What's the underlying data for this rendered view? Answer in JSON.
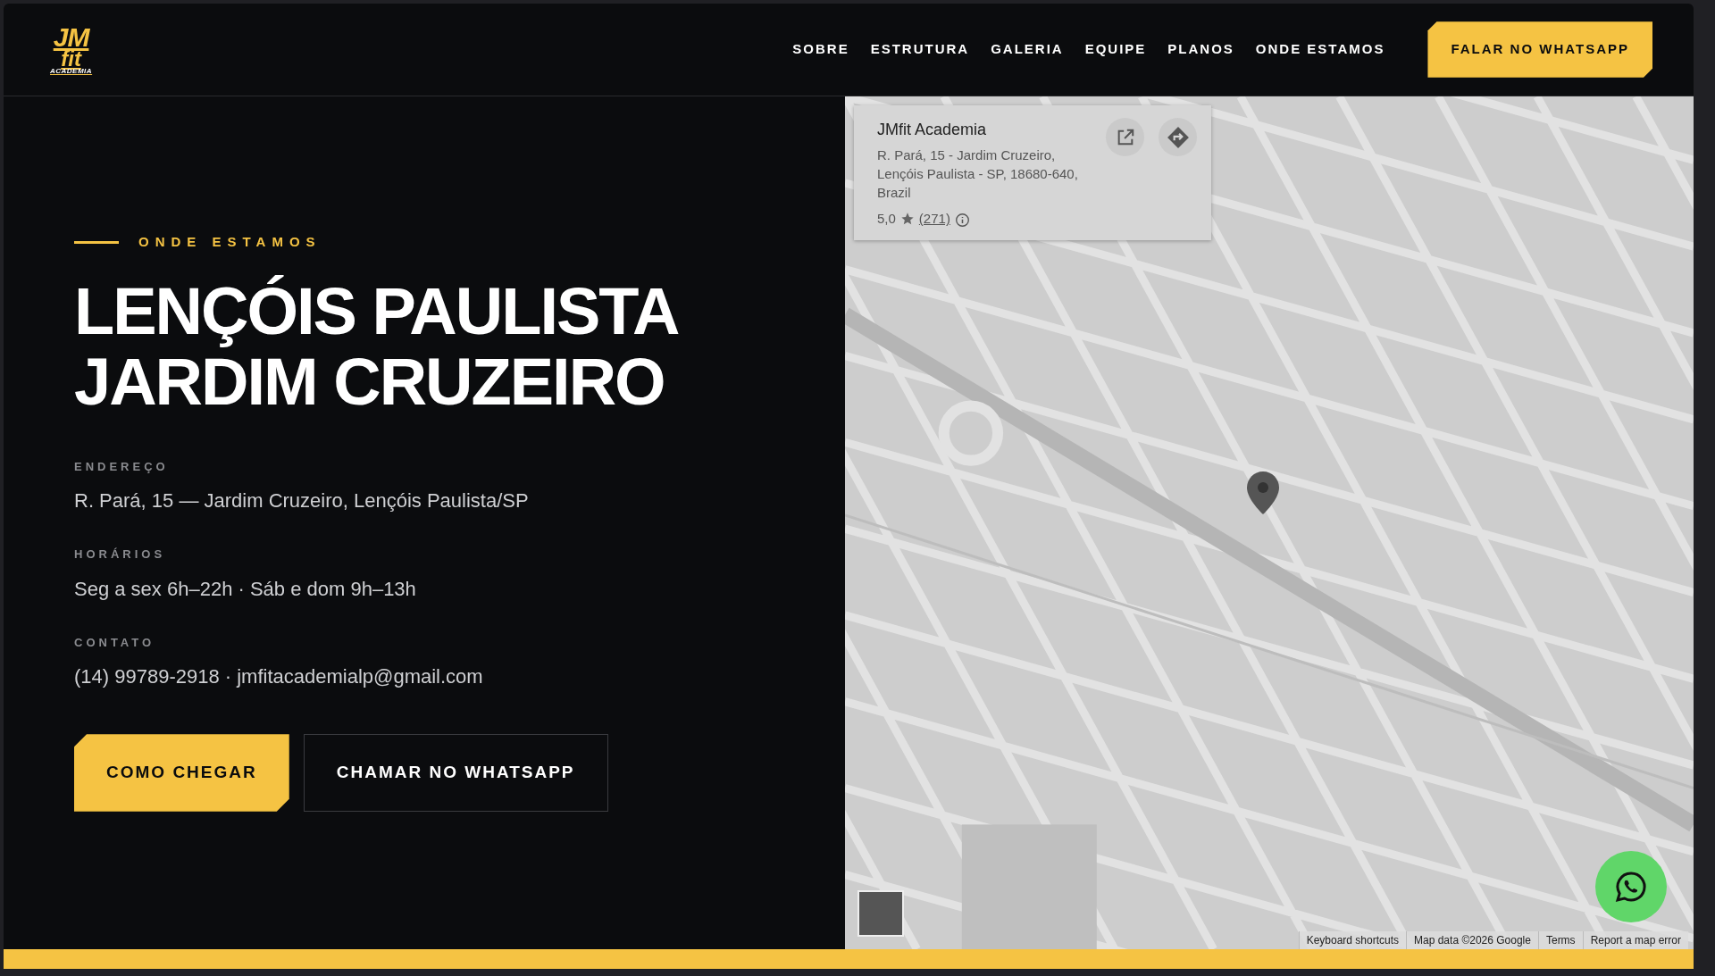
{
  "logo": {
    "mark": "JM",
    "word": "fit",
    "tagline": "ACADEMIA"
  },
  "nav": {
    "links": [
      "SOBRE",
      "ESTRUTURA",
      "GALERIA",
      "EQUIPE",
      "PLANOS",
      "ONDE ESTAMOS"
    ],
    "cta": "FALAR NO WHATSAPP"
  },
  "location": {
    "eyebrow": "ONDE ESTAMOS",
    "title_lines": [
      "LENÇÓIS PAULISTA",
      "JARDIM CRUZEIRO"
    ],
    "details": [
      {
        "label": "ENDEREÇO",
        "value": "R. Pará, 15 — Jardim Cruzeiro, Lençóis Paulista/SP"
      },
      {
        "label": "HORÁRIOS",
        "value": "Seg a sex 6h–22h · Sáb e dom 9h–13h"
      },
      {
        "label": "CONTATO",
        "value": "(14) 99789-2918 · jmfitacademialp@gmail.com"
      }
    ],
    "buttons": [
      {
        "label": "COMO CHEGAR",
        "kind": "primary"
      },
      {
        "label": "CHAMAR NO WHATSAPP",
        "kind": "outline"
      }
    ]
  },
  "map": {
    "place_card": {
      "name": "JMfit Academia",
      "address": "R. Pará, 15 - Jardim Cruzeiro, Lençóis Paulista - SP, 18680-640, Brazil",
      "rating": "5,0",
      "reviews": "(271)"
    },
    "attribution": [
      "Keyboard shortcuts",
      "Map data ©2026 Google",
      "Terms",
      "Report a map error"
    ]
  }
}
